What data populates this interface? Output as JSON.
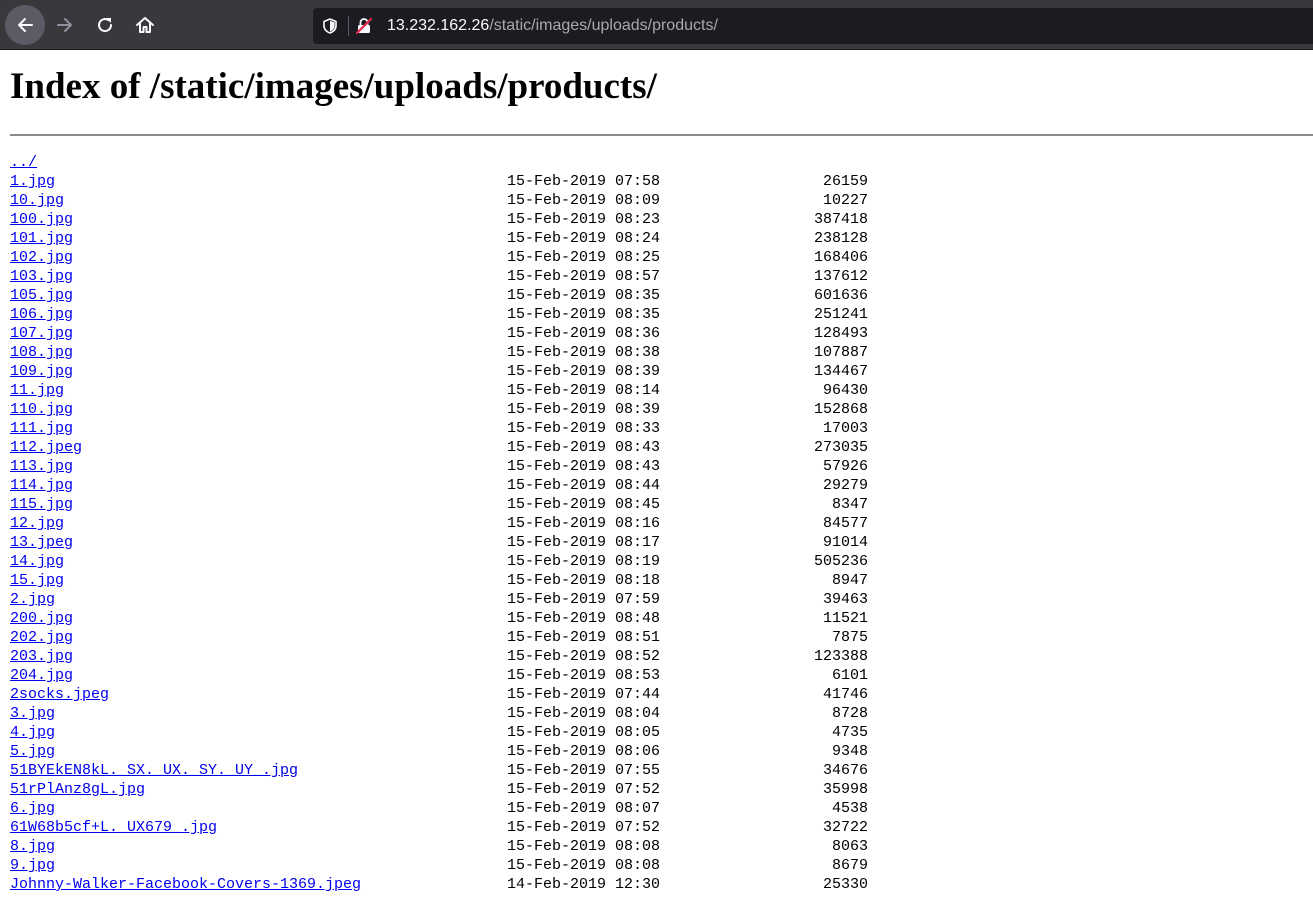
{
  "browser": {
    "url_host": "13.232.162.26",
    "url_path": "/static/images/uploads/products/"
  },
  "page": {
    "title": "Index of /static/images/uploads/products/",
    "parent_link": "../"
  },
  "entries": [
    {
      "name": "1.jpg",
      "date": "15-Feb-2019 07:58",
      "size": "26159"
    },
    {
      "name": "10.jpg",
      "date": "15-Feb-2019 08:09",
      "size": "10227"
    },
    {
      "name": "100.jpg",
      "date": "15-Feb-2019 08:23",
      "size": "387418"
    },
    {
      "name": "101.jpg",
      "date": "15-Feb-2019 08:24",
      "size": "238128"
    },
    {
      "name": "102.jpg",
      "date": "15-Feb-2019 08:25",
      "size": "168406"
    },
    {
      "name": "103.jpg",
      "date": "15-Feb-2019 08:57",
      "size": "137612"
    },
    {
      "name": "105.jpg",
      "date": "15-Feb-2019 08:35",
      "size": "601636"
    },
    {
      "name": "106.jpg",
      "date": "15-Feb-2019 08:35",
      "size": "251241"
    },
    {
      "name": "107.jpg",
      "date": "15-Feb-2019 08:36",
      "size": "128493"
    },
    {
      "name": "108.jpg",
      "date": "15-Feb-2019 08:38",
      "size": "107887"
    },
    {
      "name": "109.jpg",
      "date": "15-Feb-2019 08:39",
      "size": "134467"
    },
    {
      "name": "11.jpg",
      "date": "15-Feb-2019 08:14",
      "size": "96430"
    },
    {
      "name": "110.jpg",
      "date": "15-Feb-2019 08:39",
      "size": "152868"
    },
    {
      "name": "111.jpg",
      "date": "15-Feb-2019 08:33",
      "size": "17003"
    },
    {
      "name": "112.jpeg",
      "date": "15-Feb-2019 08:43",
      "size": "273035"
    },
    {
      "name": "113.jpg",
      "date": "15-Feb-2019 08:43",
      "size": "57926"
    },
    {
      "name": "114.jpg",
      "date": "15-Feb-2019 08:44",
      "size": "29279"
    },
    {
      "name": "115.jpg",
      "date": "15-Feb-2019 08:45",
      "size": "8347"
    },
    {
      "name": "12.jpg",
      "date": "15-Feb-2019 08:16",
      "size": "84577"
    },
    {
      "name": "13.jpeg",
      "date": "15-Feb-2019 08:17",
      "size": "91014"
    },
    {
      "name": "14.jpg",
      "date": "15-Feb-2019 08:19",
      "size": "505236"
    },
    {
      "name": "15.jpg",
      "date": "15-Feb-2019 08:18",
      "size": "8947"
    },
    {
      "name": "2.jpg",
      "date": "15-Feb-2019 07:59",
      "size": "39463"
    },
    {
      "name": "200.jpg",
      "date": "15-Feb-2019 08:48",
      "size": "11521"
    },
    {
      "name": "202.jpg",
      "date": "15-Feb-2019 08:51",
      "size": "7875"
    },
    {
      "name": "203.jpg",
      "date": "15-Feb-2019 08:52",
      "size": "123388"
    },
    {
      "name": "204.jpg",
      "date": "15-Feb-2019 08:53",
      "size": "6101"
    },
    {
      "name": "2socks.jpeg",
      "date": "15-Feb-2019 07:44",
      "size": "41746"
    },
    {
      "name": "3.jpg",
      "date": "15-Feb-2019 08:04",
      "size": "8728"
    },
    {
      "name": "4.jpg",
      "date": "15-Feb-2019 08:05",
      "size": "4735"
    },
    {
      "name": "5.jpg",
      "date": "15-Feb-2019 08:06",
      "size": "9348"
    },
    {
      "name": "51BYEkEN8kL._SX._UX._SY._UY_.jpg",
      "date": "15-Feb-2019 07:55",
      "size": "34676"
    },
    {
      "name": "51rPlAnz8gL.jpg",
      "date": "15-Feb-2019 07:52",
      "size": "35998"
    },
    {
      "name": "6.jpg",
      "date": "15-Feb-2019 08:07",
      "size": "4538"
    },
    {
      "name": "61W68b5cf+L._UX679_.jpg",
      "date": "15-Feb-2019 07:52",
      "size": "32722"
    },
    {
      "name": "8.jpg",
      "date": "15-Feb-2019 08:08",
      "size": "8063"
    },
    {
      "name": "9.jpg",
      "date": "15-Feb-2019 08:08",
      "size": "8679"
    },
    {
      "name": "Johnny-Walker-Facebook-Covers-1369.jpeg",
      "date": "14-Feb-2019 12:30",
      "size": "25330"
    }
  ]
}
